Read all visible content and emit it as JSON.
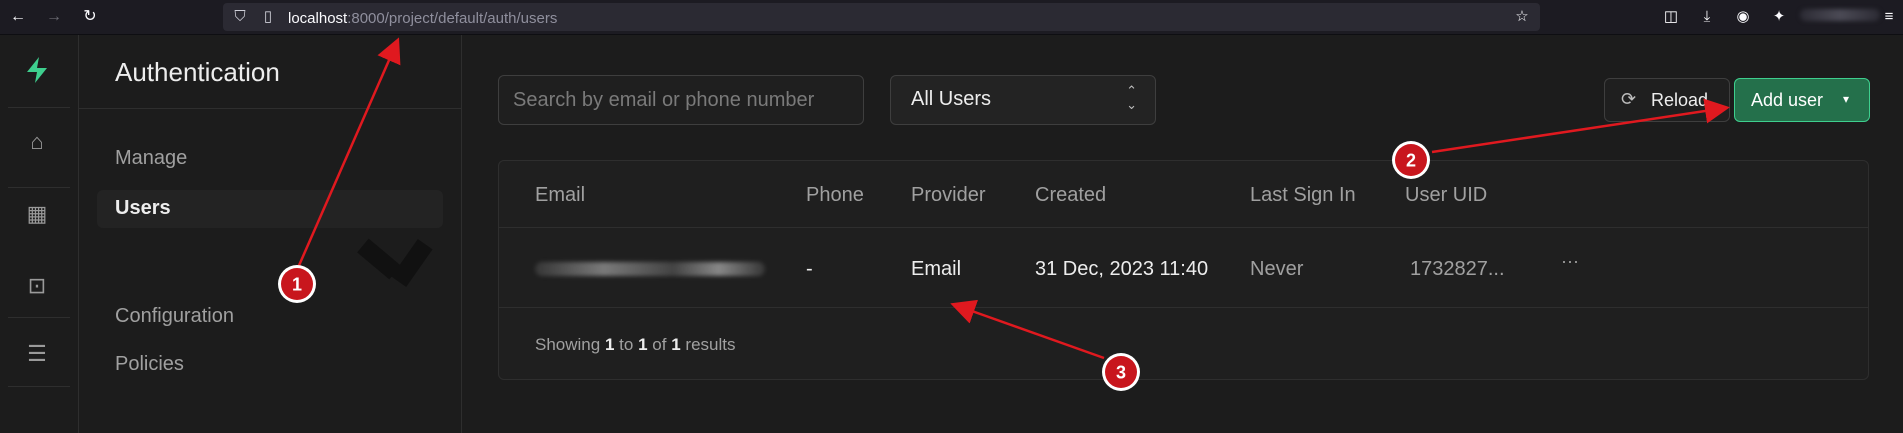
{
  "browser": {
    "url_host": "localhost",
    "url_rest": ":8000/project/default/auth/users"
  },
  "rail": {
    "icons": [
      "supabase-logo-icon",
      "home-icon",
      "table-icon",
      "terminal-icon",
      "storage-icon"
    ]
  },
  "subnav": {
    "title": "Authentication",
    "items": [
      {
        "label": "Manage",
        "active": false
      },
      {
        "label": "Users",
        "active": true
      },
      {
        "label": "Configuration",
        "active": false
      },
      {
        "label": "Policies",
        "active": false
      }
    ]
  },
  "toolbar": {
    "search_placeholder": "Search by email or phone number",
    "filter_value": "All Users",
    "reload_label": "Reload",
    "add_user_label": "Add user"
  },
  "table": {
    "columns": [
      "Email",
      "Phone",
      "Provider",
      "Created",
      "Last Sign In",
      "User UID"
    ],
    "rows": [
      {
        "phone": "-",
        "provider": "Email",
        "created": "31 Dec, 2023 11:40",
        "last_sign_in": "Never",
        "uid": "1732827...",
        "more": "···"
      }
    ],
    "footer": {
      "prefix": "Showing",
      "from": "1",
      "to_word": "to",
      "to": "1",
      "of_word": "of",
      "total": "1",
      "suffix": "results"
    }
  },
  "annotations": [
    {
      "label": "1"
    },
    {
      "label": "2"
    },
    {
      "label": "3"
    }
  ],
  "colors": {
    "brand": "#3ecf8e",
    "add_button": "#24704b",
    "annotation": "#e0191f"
  }
}
